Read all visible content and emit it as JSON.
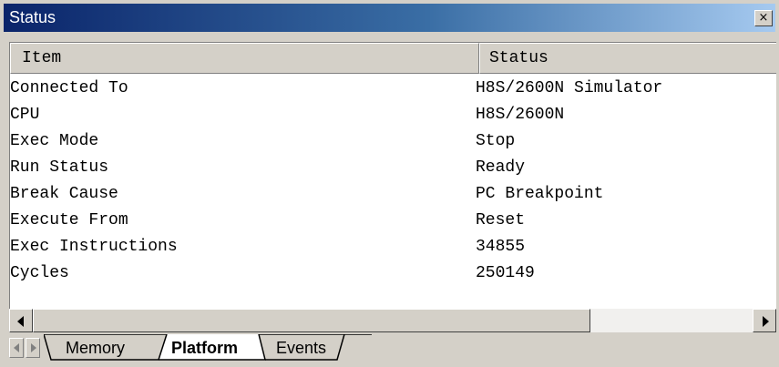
{
  "window": {
    "title": "Status",
    "close_glyph": "×"
  },
  "table": {
    "columns": [
      "Item",
      "Status"
    ],
    "rows": [
      {
        "item": "Connected To",
        "status": "H8S/2600N Simulator"
      },
      {
        "item": "CPU",
        "status": "H8S/2600N"
      },
      {
        "item": "Exec Mode",
        "status": "Stop"
      },
      {
        "item": "Run Status",
        "status": "Ready"
      },
      {
        "item": "Break Cause",
        "status": "PC Breakpoint"
      },
      {
        "item": "Execute From",
        "status": "Reset"
      },
      {
        "item": "Exec Instructions",
        "status": "34855"
      },
      {
        "item": "Cycles",
        "status": "250149"
      }
    ]
  },
  "tabs": [
    {
      "label": "Memory",
      "active": false
    },
    {
      "label": "Platform",
      "active": true
    },
    {
      "label": "Events",
      "active": false
    }
  ],
  "icons": {
    "close": "close-icon",
    "scroll_left": "arrow-left-icon",
    "scroll_right": "arrow-right-icon",
    "tab_prev": "arrow-left-icon",
    "tab_next": "arrow-right-icon"
  },
  "colors": {
    "titlebar_start": "#0a246a",
    "titlebar_end": "#a6caf0",
    "face": "#d4d0c8"
  }
}
